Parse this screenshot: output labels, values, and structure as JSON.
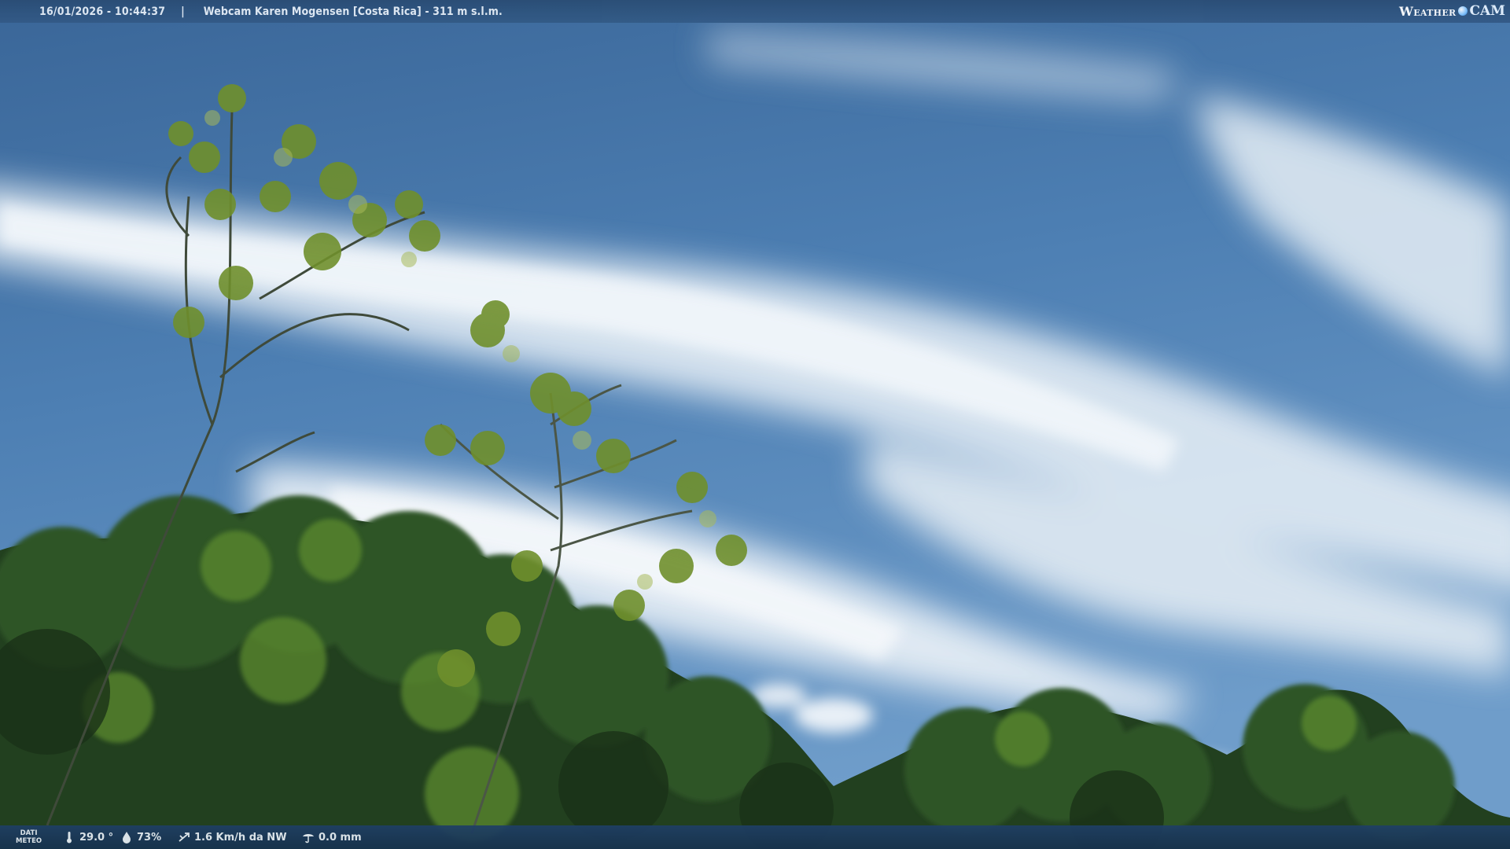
{
  "header": {
    "timestamp": "16/01/2026 - 10:44:37",
    "separator": "|",
    "title": "Webcam Karen Mogensen [Costa Rica] - 311 m s.l.m."
  },
  "logo": {
    "word1": "Weather",
    "word2": "CAM"
  },
  "weather": {
    "label_line1": "DATI",
    "label_line2": "METEO",
    "temperature": "29.0 °",
    "humidity": "73%",
    "wind": "1.6 Km/h da NW",
    "rain": "0.0 mm",
    "icons": [
      "thermometer-icon",
      "humidity-drop-icon",
      "wind-icon",
      "rain-gauge-icon"
    ]
  },
  "colors": {
    "sky_top": "#3d6a9c",
    "sky_mid": "#5f8fc0",
    "cloud": "#e6eef6",
    "foliage_dark": "#1e3a1c",
    "foliage_light": "#7a9a3a",
    "bar": "#2a4c74"
  }
}
